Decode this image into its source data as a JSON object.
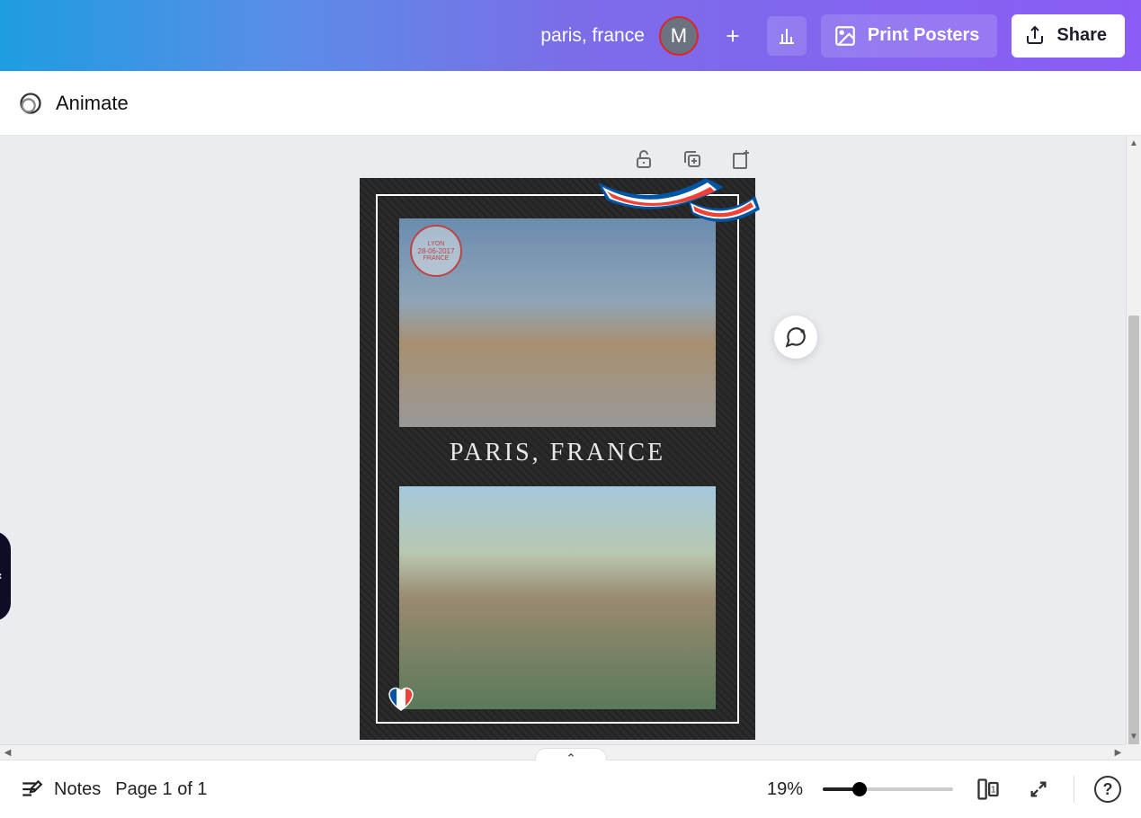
{
  "header": {
    "doc_title": "paris, france",
    "avatar_initial": "M",
    "print_label": "Print Posters",
    "share_label": "Share"
  },
  "toolbar": {
    "animate_label": "Animate"
  },
  "poster": {
    "title": "PARIS, FRANCE",
    "stamp_top": "LYON",
    "stamp_date": "28-06-2017",
    "stamp_bottom": "FRANCE"
  },
  "bottom": {
    "notes_label": "Notes",
    "page_label": "Page 1 of 1",
    "zoom_pct": "19%",
    "help_label": "?",
    "grid_value": "1"
  },
  "colors": {
    "france_blue": "#0055a4",
    "france_white": "#ffffff",
    "france_red": "#ef4135"
  }
}
